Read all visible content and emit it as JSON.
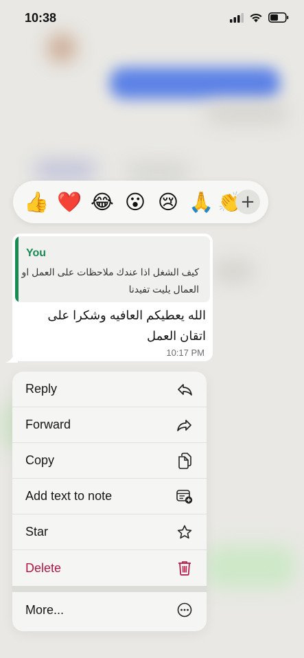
{
  "status_bar": {
    "time": "10:38"
  },
  "reactions": {
    "emojis": [
      {
        "name": "thumbs-up-emoji",
        "glyph": "👍"
      },
      {
        "name": "red-heart-emoji",
        "glyph": "❤️"
      },
      {
        "name": "tears-of-joy-emoji",
        "glyph": "😂"
      },
      {
        "name": "surprised-emoji",
        "glyph": "😮"
      },
      {
        "name": "crying-emoji",
        "glyph": "😢"
      },
      {
        "name": "folded-hands-emoji",
        "glyph": "🙏"
      },
      {
        "name": "clapping-emoji",
        "glyph": "👏"
      }
    ],
    "more_label": "+"
  },
  "message": {
    "quote_author": "You",
    "quote_text": "كيف الشغل اذا عندك ملاحظات على العمل او العمال يليت تفيدنا",
    "text": "الله يعطيكم العافيه وشكرا على اتقان العمل",
    "time": "10:17 PM"
  },
  "menu": {
    "items": [
      {
        "label": "Reply",
        "icon": "reply-icon"
      },
      {
        "label": "Forward",
        "icon": "forward-icon"
      },
      {
        "label": "Copy",
        "icon": "copy-icon"
      },
      {
        "label": "Add text to note",
        "icon": "add-note-icon"
      },
      {
        "label": "Star",
        "icon": "star-icon"
      },
      {
        "label": "Delete",
        "icon": "trash-icon"
      }
    ],
    "more_label": "More..."
  },
  "colors": {
    "accent_green": "#1a8a55",
    "delete_red": "#b01745",
    "blurred_bubble_blue": "#5c82e6"
  }
}
